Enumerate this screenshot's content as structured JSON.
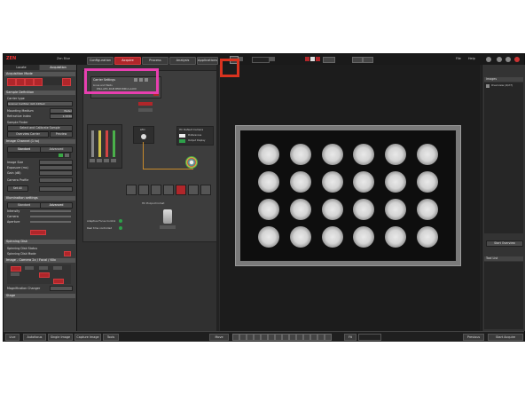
{
  "app": {
    "logo_text": "ZEN",
    "top_right_label": "Zen Blue"
  },
  "top_tabs": [
    "Configuration",
    "Acquire",
    "Process",
    "Analysis",
    "Applications"
  ],
  "active_tab": "Acquire",
  "menu_right": [
    "File",
    "Help"
  ],
  "left_panel": {
    "tabs": [
      "Locate",
      "Acquisition"
    ],
    "sections": {
      "acquisition_mode": "Acquisition Mode",
      "sample_definition": "Sample Definition",
      "carrier_type_label": "Carrier type",
      "carrier_type_value": "Greiner CellStar 4x6 24Well",
      "mounting_medium_label": "Mounting Medium",
      "mounting_medium_value": "Water",
      "refractive_index_label": "Refractive index",
      "refractive_index_value": "1.3330",
      "sample_finder": "Sample Finder",
      "select_carrier_button": "Select and Calibrate Sample",
      "overview_button": "Overview Carrier",
      "preview_button": "Preview",
      "image_channel": "Image Channel (1 to)",
      "standard": "Standard",
      "advanced": "Advanced",
      "image_size_label": "Image Size",
      "exposure_label": "Exposure (ms)",
      "gain_label": "Gain (dB)",
      "camera_profile_label": "Camera Profile",
      "set_all_button": "Set All",
      "illumination_settings": "Illumination settings",
      "intensity_label": "Intensity",
      "camera_label": "Camera",
      "aperture_label": "Aperture",
      "spinning_disk": "Spinning Disk",
      "spinning_disk_status": "Spinning Disk Status",
      "spinning_disk_mode": "Spinning Disk Mode",
      "image_camera": "Image - Camera 2x / Focal / 60x",
      "magnification_changer": "Magnification Changer",
      "stage": "Stage"
    }
  },
  "light_path": {
    "popup_title": "Carrier Settings",
    "popup_lines": [
      "Lines and Wells",
      "DNA-AEC-DAPI-BMM-BRCA-AA00",
      "DNA-AEC-DAPI-BMM-BRCA-AA00"
    ],
    "lamp_label": "LED",
    "camera_label": "HC Default Camera",
    "preferences_label": "Preferences",
    "output_label": "Output Display",
    "objective_label": "HC Pl.Apochromat",
    "adaptive_focus": "Adaptive Focus Control",
    "realtime": "Real time controlled"
  },
  "right_panel": {
    "title": "Images",
    "item": "Overview (4/27)",
    "start_overview": "Start Overview",
    "tool_list": "Tool List"
  },
  "bottom_bar": {
    "buttons": [
      "Live",
      "Autofocus",
      "Single Image",
      "Capture Image",
      "Tools"
    ],
    "center_label": "Move",
    "zoom_label": "Fit",
    "right_buttons": [
      "Previous",
      "Start Acquire"
    ]
  },
  "plate": {
    "rows": 4,
    "cols": 6
  },
  "colors": {
    "accent_red": "#b0262a",
    "pink_annotation": "#e83fb0",
    "red_annotation": "#d9331f"
  }
}
